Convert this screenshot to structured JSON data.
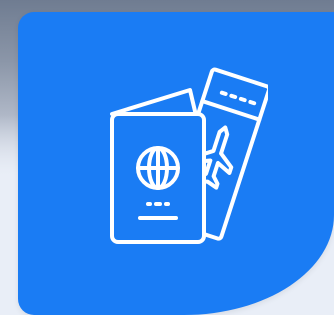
{
  "card": {
    "background_color": "#1a7cf4",
    "icon": "passport-and-boarding-pass-icon",
    "icon_color": "#ffffff"
  }
}
